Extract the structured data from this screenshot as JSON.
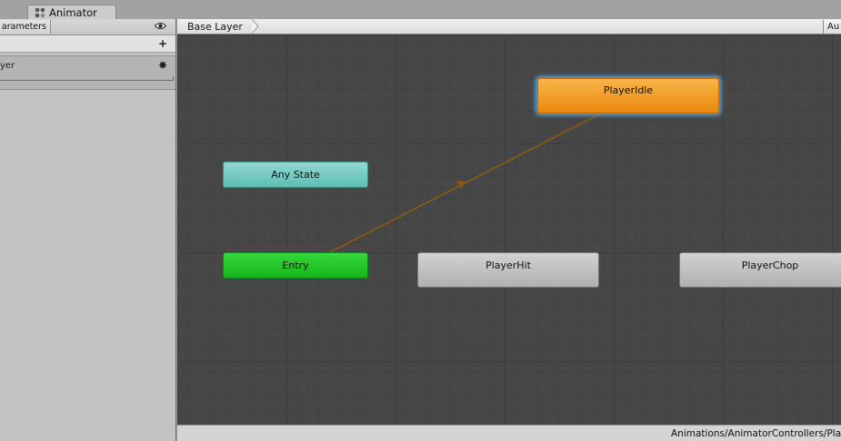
{
  "window": {
    "tab_label": "Animator",
    "tab_icon": "animator-icon"
  },
  "left_panel": {
    "tab_label": "Parameters",
    "tab_visible_label": "arameters",
    "eye_icon": "eye-icon",
    "add_icon": "plus-icon",
    "layer": {
      "name": "Base Layer",
      "visible_name": "yer",
      "settings_icon": "gear-icon"
    }
  },
  "breadcrumb": {
    "label": "Base Layer",
    "auto_button_label": "Auto Live Link",
    "auto_button_visible": "Au"
  },
  "graph": {
    "states": {
      "any_state": "Any State",
      "entry": "Entry",
      "idle": "PlayerIdle",
      "hit": "PlayerHit",
      "chop": "PlayerChop"
    },
    "transition_from": "Entry",
    "transition_to": "PlayerIdle",
    "colors": {
      "any_state": "#6ccbc1",
      "entry": "#22c527",
      "default_state": "#ea8a0c",
      "state": "#c0c0c0",
      "transition": "#8a5a12",
      "selection_glow": "#5aaeea"
    }
  },
  "status_bar": {
    "path": "Animations/AnimatorControllers/Play"
  }
}
